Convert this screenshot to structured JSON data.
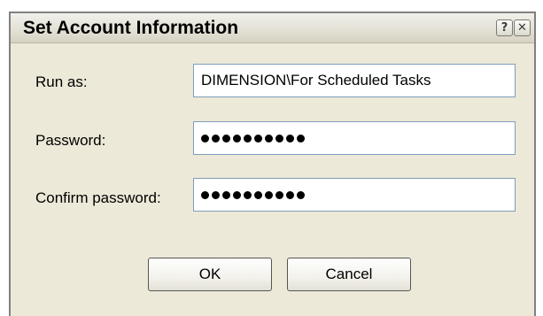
{
  "window": {
    "title": "Set Account Information",
    "help_icon": "help-icon",
    "help_glyph": "?",
    "close_icon": "close-icon",
    "close_glyph": "✕"
  },
  "form": {
    "run_as": {
      "label": "Run as:",
      "value": "DIMENSION\\For Scheduled Tasks"
    },
    "password": {
      "label": "Password:",
      "masked_length": 10
    },
    "confirm_password": {
      "label": "Confirm password:",
      "masked_length": 10
    }
  },
  "buttons": {
    "ok_label": "OK",
    "cancel_label": "Cancel"
  }
}
